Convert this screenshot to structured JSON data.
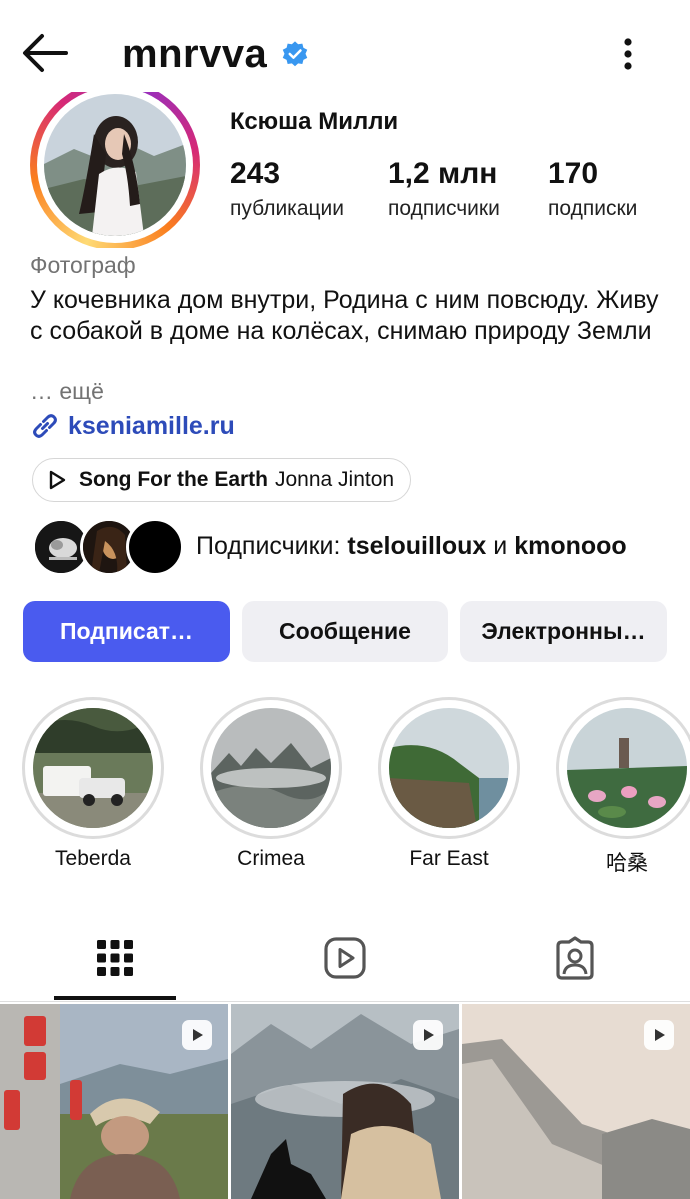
{
  "header": {
    "username": "mnrvva",
    "back_icon": "arrow-left-icon",
    "verified_icon": "verified-badge-icon",
    "menu_icon": "more-vertical-icon"
  },
  "profile": {
    "full_name": "Ксюша Милли",
    "stats": [
      {
        "value": "243",
        "label": "публикации"
      },
      {
        "value": "1,2 млн",
        "label": "подписчики"
      },
      {
        "value": "170",
        "label": "подписки"
      }
    ],
    "category": "Фотограф",
    "bio": "У кочевника дом внутри, Родина с ним повсюду. Живу с собакой в доме на колёсах, снимаю природу Земли",
    "more": "… ещё",
    "link": "kseniamille.ru",
    "song": {
      "title": "Song For the Earth",
      "artist": "Jonna Jinton"
    },
    "followers": {
      "prefix": "Подписчики: ",
      "name1": "tselouilloux",
      "conj": " и ",
      "name2": "kmonooo"
    }
  },
  "actions": {
    "follow": "Подписат…",
    "message": "Сообщение",
    "email": "Электронны…"
  },
  "highlights": [
    {
      "name": "Teberda"
    },
    {
      "name": "Crimea"
    },
    {
      "name": "Far East"
    },
    {
      "name": "哈桑"
    }
  ],
  "tabs": [
    {
      "icon": "grid-icon",
      "active": true
    },
    {
      "icon": "reels-icon",
      "active": false
    },
    {
      "icon": "tagged-icon",
      "active": false
    }
  ],
  "colors": {
    "primary": "#4a5bef",
    "link": "#2d4bb9",
    "verified": "#3897f0",
    "secondary_button": "#efeff3",
    "muted_text": "#737373"
  }
}
